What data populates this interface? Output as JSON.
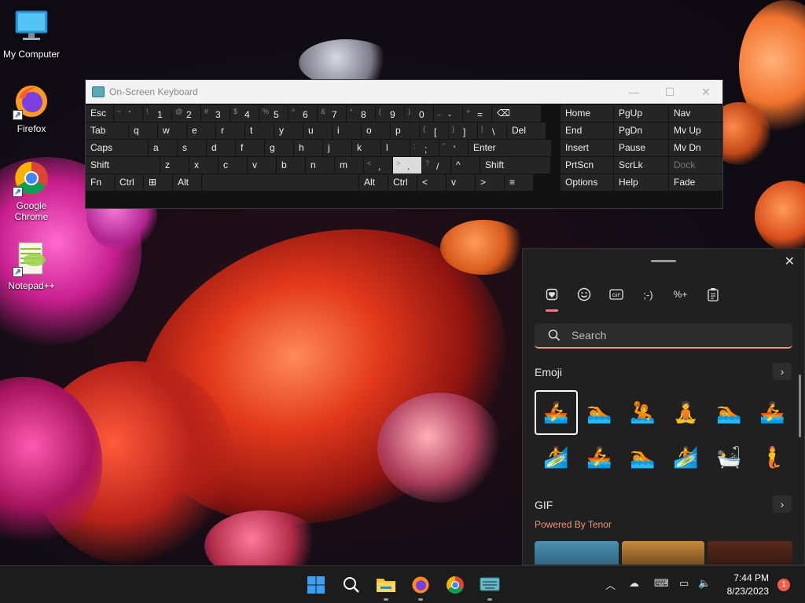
{
  "desktop": {
    "icons": [
      {
        "label": "My Computer",
        "icon": "monitor-icon"
      },
      {
        "label": "Firefox",
        "icon": "firefox-icon"
      },
      {
        "label": "Google Chrome",
        "icon": "chrome-icon"
      },
      {
        "label": "Notepad++",
        "icon": "notepadpp-icon"
      }
    ]
  },
  "osk": {
    "title": "On-Screen Keyboard",
    "rows": [
      [
        {
          "t": "Esc"
        },
        {
          "s": "~",
          "m": "`"
        },
        {
          "s": "!",
          "m": "1"
        },
        {
          "s": "@",
          "m": "2"
        },
        {
          "s": "#",
          "m": "3"
        },
        {
          "s": "$",
          "m": "4"
        },
        {
          "s": "%",
          "m": "5"
        },
        {
          "s": "^",
          "m": "6"
        },
        {
          "s": "&",
          "m": "7"
        },
        {
          "s": "*",
          "m": "8"
        },
        {
          "s": "(",
          "m": "9"
        },
        {
          "s": ")",
          "m": "0"
        },
        {
          "s": "_",
          "m": "-"
        },
        {
          "s": "+",
          "m": "="
        },
        {
          "t": "⌫"
        }
      ],
      [
        {
          "t": "Tab"
        },
        {
          "t": "q"
        },
        {
          "t": "w"
        },
        {
          "t": "e"
        },
        {
          "t": "r"
        },
        {
          "t": "t"
        },
        {
          "t": "y"
        },
        {
          "t": "u"
        },
        {
          "t": "i"
        },
        {
          "t": "o"
        },
        {
          "t": "p"
        },
        {
          "s": "{",
          "m": "["
        },
        {
          "s": "}",
          "m": "]"
        },
        {
          "s": "|",
          "m": "\\"
        },
        {
          "t": "Del"
        }
      ],
      [
        {
          "t": "Caps"
        },
        {
          "t": "a"
        },
        {
          "t": "s"
        },
        {
          "t": "d"
        },
        {
          "t": "f"
        },
        {
          "t": "g"
        },
        {
          "t": "h"
        },
        {
          "t": "j"
        },
        {
          "t": "k"
        },
        {
          "t": "l"
        },
        {
          "s": ":",
          "m": ";"
        },
        {
          "s": "\"",
          "m": "'"
        },
        {
          "t": "Enter"
        }
      ],
      [
        {
          "t": "Shift"
        },
        {
          "t": "z"
        },
        {
          "t": "x"
        },
        {
          "t": "c"
        },
        {
          "t": "v"
        },
        {
          "t": "b"
        },
        {
          "t": "n"
        },
        {
          "t": "m"
        },
        {
          "s": "<",
          "m": ","
        },
        {
          "s": ">",
          "m": "."
        },
        {
          "s": "?",
          "m": "/"
        },
        {
          "t": "^"
        },
        {
          "t": "Shift"
        }
      ],
      [
        {
          "t": "Fn"
        },
        {
          "t": "Ctrl"
        },
        {
          "t": "⊞"
        },
        {
          "t": "Alt"
        },
        {
          "t": ""
        },
        {
          "t": "Alt"
        },
        {
          "t": "Ctrl"
        },
        {
          "t": "<"
        },
        {
          "t": "v"
        },
        {
          "t": ">"
        },
        {
          "t": "≡"
        }
      ]
    ],
    "nav": [
      [
        "Home",
        "PgUp",
        "Nav"
      ],
      [
        "End",
        "PgDn",
        "Mv Up"
      ],
      [
        "Insert",
        "Pause",
        "Mv Dn"
      ],
      [
        "PrtScn",
        "ScrLk",
        "Dock"
      ],
      [
        "Options",
        "Help",
        "Fade"
      ]
    ]
  },
  "emoji_panel": {
    "tabs": [
      "heart-icon",
      "smiley-icon",
      "gif-icon",
      "kaomoji-icon",
      "symbols-icon",
      "clipboard-icon"
    ],
    "search_placeholder": "Search",
    "emoji_heading": "Emoji",
    "emojis": [
      "🚣",
      "🏊",
      "🤽",
      "🧘",
      "🏊",
      "🚣",
      "🏄",
      "🚣",
      "🏊",
      "🏄",
      "🛀",
      "🧜"
    ],
    "gif_heading": "GIF",
    "tenor_text": "Powered By Tenor"
  },
  "taskbar": {
    "apps": [
      "windows-start-icon",
      "search-icon",
      "file-explorer-icon",
      "firefox-icon",
      "chrome-icon",
      "osk-icon"
    ],
    "time": "7:44 PM",
    "date": "8/23/2023",
    "notifications": "1",
    "colors": {
      "accent": "#f0927a",
      "notification": "#f25c4a"
    }
  }
}
